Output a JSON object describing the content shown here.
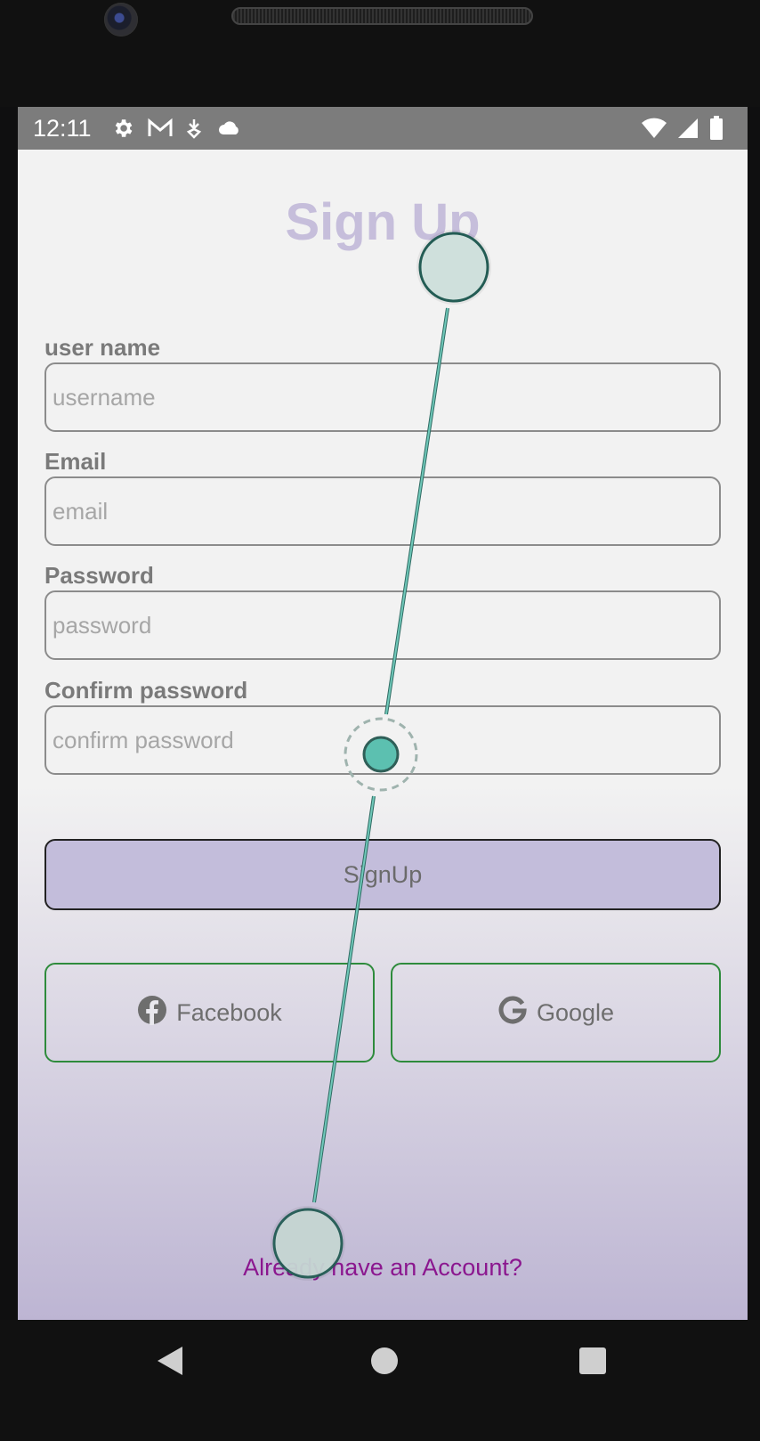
{
  "status_bar": {
    "time": "12:11",
    "left_icons": [
      "gear-icon",
      "gmail-icon",
      "download-icon",
      "cloud-icon"
    ],
    "right_icons": [
      "wifi-icon",
      "signal-icon",
      "battery-icon"
    ]
  },
  "form": {
    "title": "Sign Up",
    "fields": [
      {
        "label": "user name",
        "placeholder": "username",
        "value": ""
      },
      {
        "label": "Email",
        "placeholder": "email",
        "value": ""
      },
      {
        "label": "Password",
        "placeholder": "password",
        "value": ""
      },
      {
        "label": "Confirm password",
        "placeholder": "confirm password",
        "value": ""
      }
    ],
    "signup_label": "SignUp",
    "social": {
      "facebook_label": "Facebook",
      "google_label": "Google"
    },
    "account_link": "Already have an Account?"
  },
  "nav_bar": [
    "back-icon",
    "home-icon",
    "recents-icon"
  ],
  "colors": {
    "title": "#c6bedb",
    "signup_button": "#c3bddb",
    "social_border": "#2e8b3c",
    "link": "#8b178f",
    "gesture": "#5cc0b0"
  }
}
